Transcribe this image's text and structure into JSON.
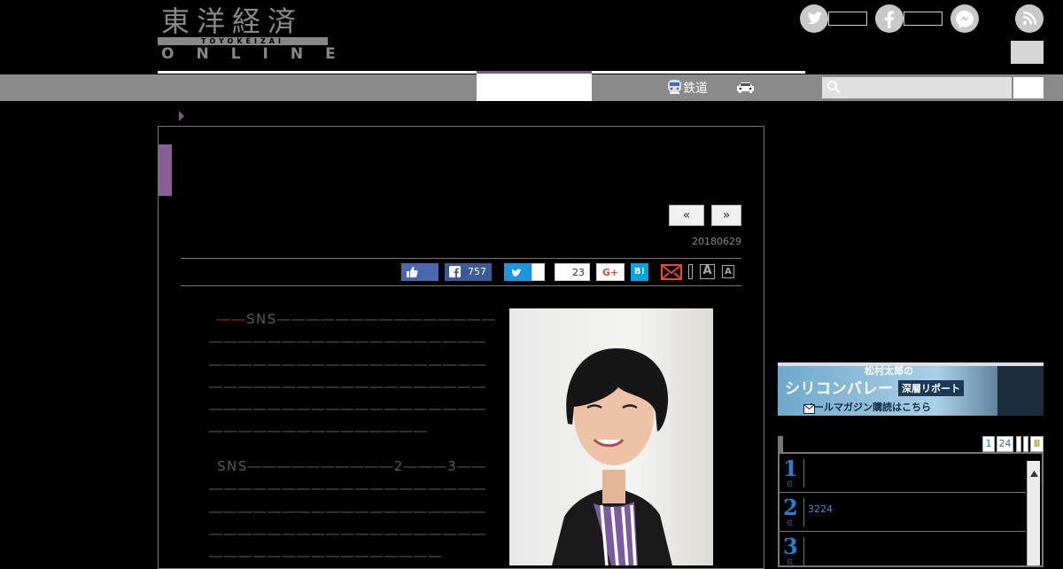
{
  "header": {
    "logo_main": "東洋経済",
    "logo_bar": "TOYOKEIZAI",
    "logo_sub": "ONLINE",
    "icons": [
      "twitter-icon",
      "facebook-icon",
      "messenger-icon",
      "rss-icon"
    ]
  },
  "nav": {
    "rail_label": "鉄道",
    "icons": [
      "train-icon",
      "car-icon",
      "search-icon"
    ],
    "search_placeholder": ""
  },
  "article": {
    "pager_prev": "«",
    "pager_next": "»",
    "date": "20180629",
    "share": {
      "facebook_count": "757",
      "hatena_count": "23",
      "gplus_label": "G+",
      "hatena_label": "B!",
      "font_large": "A",
      "font_small": "A"
    },
    "para1_lead": "――",
    "para1": "SNS――――――――――――――――――――――――――――――――――――――――――――――――――――――――――――――――――――――――――――――――――――――――――――――――――――――――――",
    "para2": "SNS――――――――――2―――3―――――――――――――――――――――――――――――――――――――――――――――――――――――――――――――――――――――――――――"
  },
  "sidebar": {
    "banner_line1": "松村太郎の",
    "banner_line2": "シリコンバレー",
    "banner_line3": "深層リポート",
    "banner_line4": "メールマガジン購読はこちら",
    "tabs": [
      "1",
      "24"
    ],
    "tab_extra": "Ⅲ",
    "ranking": [
      {
        "rank": "1",
        "suffix": "位",
        "text": ""
      },
      {
        "rank": "2",
        "suffix": "位",
        "text": "3224"
      },
      {
        "rank": "3",
        "suffix": "位",
        "text": ""
      }
    ]
  },
  "colors": {
    "accent": "#8a5f96",
    "nav": "#8a8a8a",
    "link": "#2b7fd1"
  }
}
